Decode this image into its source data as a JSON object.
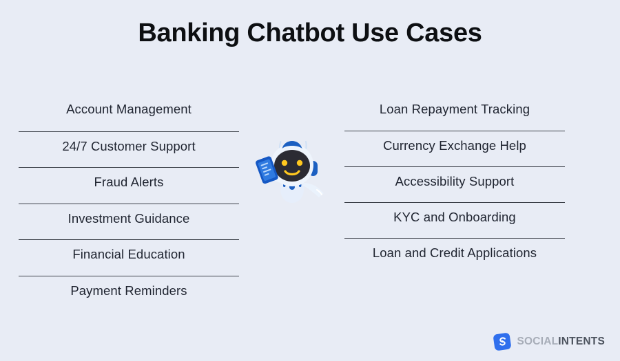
{
  "title": "Banking Chatbot Use Cases",
  "background_color": "#e8ecf5",
  "columns": {
    "left": [
      {
        "label": "Account Management"
      },
      {
        "label": "24/7 Customer Support"
      },
      {
        "label": "Fraud Alerts"
      },
      {
        "label": "Investment Guidance"
      },
      {
        "label": "Financial Education"
      },
      {
        "label": "Payment Reminders"
      }
    ],
    "right": [
      {
        "label": "Loan Repayment Tracking"
      },
      {
        "label": "Currency Exchange Help"
      },
      {
        "label": "Accessibility Support"
      },
      {
        "label": "KYC and Onboarding"
      },
      {
        "label": "Loan and Credit Applications"
      }
    ]
  },
  "mascot": {
    "icon": "chatbot-robot-holding-phone-icon",
    "body_color": "#eaf1fb",
    "accent_color": "#1b5fc1",
    "face_color": "#2b2b33",
    "eye_color": "#ffc81f"
  },
  "logo": {
    "mark_icon": "social-intents-logo-mark",
    "mark_color": "#2f6fed",
    "text_primary": "SOCIAL",
    "text_secondary": "INTENTS",
    "primary_color": "#a7adb8",
    "secondary_color": "#4c535e"
  }
}
